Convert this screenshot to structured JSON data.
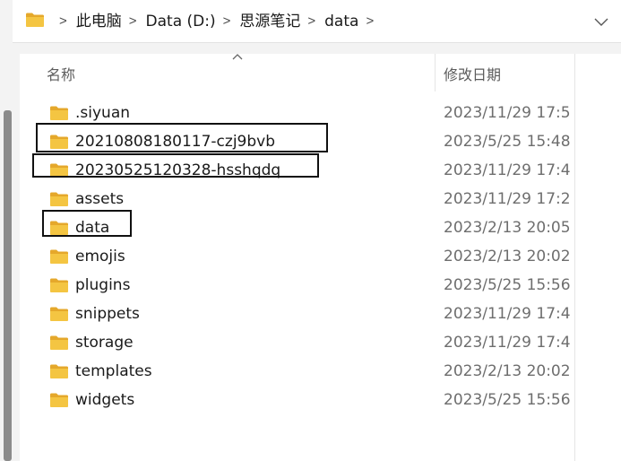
{
  "address_bar": {
    "crumbs": [
      "此电脑",
      "Data (D:)",
      "思源笔记",
      "data"
    ],
    "separator": ">"
  },
  "columns": {
    "name": "名称",
    "date_modified": "修改日期"
  },
  "colors": {
    "folder": "#f4c542",
    "folder_back": "#e5a82b",
    "highlight": "#111111"
  },
  "files": [
    {
      "name": ".siyuan",
      "date": "2023/11/29 17:5",
      "icon": "folder-icon",
      "highlighted": false
    },
    {
      "name": "20210808180117-czj9bvb",
      "date": "2023/5/25 15:48",
      "icon": "folder-icon",
      "highlighted": true
    },
    {
      "name": "20230525120328-hsshqdq",
      "date": "2023/11/29 17:4",
      "icon": "folder-icon",
      "highlighted": true
    },
    {
      "name": "assets",
      "date": "2023/11/29 17:2",
      "icon": "folder-icon",
      "highlighted": false
    },
    {
      "name": "data",
      "date": "2023/2/13 20:05",
      "icon": "folder-icon",
      "highlighted": true
    },
    {
      "name": "emojis",
      "date": "2023/2/13 20:02",
      "icon": "folder-icon",
      "highlighted": false
    },
    {
      "name": "plugins",
      "date": "2023/5/25 15:56",
      "icon": "folder-icon",
      "highlighted": false
    },
    {
      "name": "snippets",
      "date": "2023/11/29 17:4",
      "icon": "folder-icon",
      "highlighted": false
    },
    {
      "name": "storage",
      "date": "2023/11/29 17:4",
      "icon": "folder-icon",
      "highlighted": false
    },
    {
      "name": "templates",
      "date": "2023/2/13 20:02",
      "icon": "folder-icon",
      "highlighted": false
    },
    {
      "name": "widgets",
      "date": "2023/5/25 15:56",
      "icon": "folder-icon",
      "highlighted": false
    }
  ]
}
